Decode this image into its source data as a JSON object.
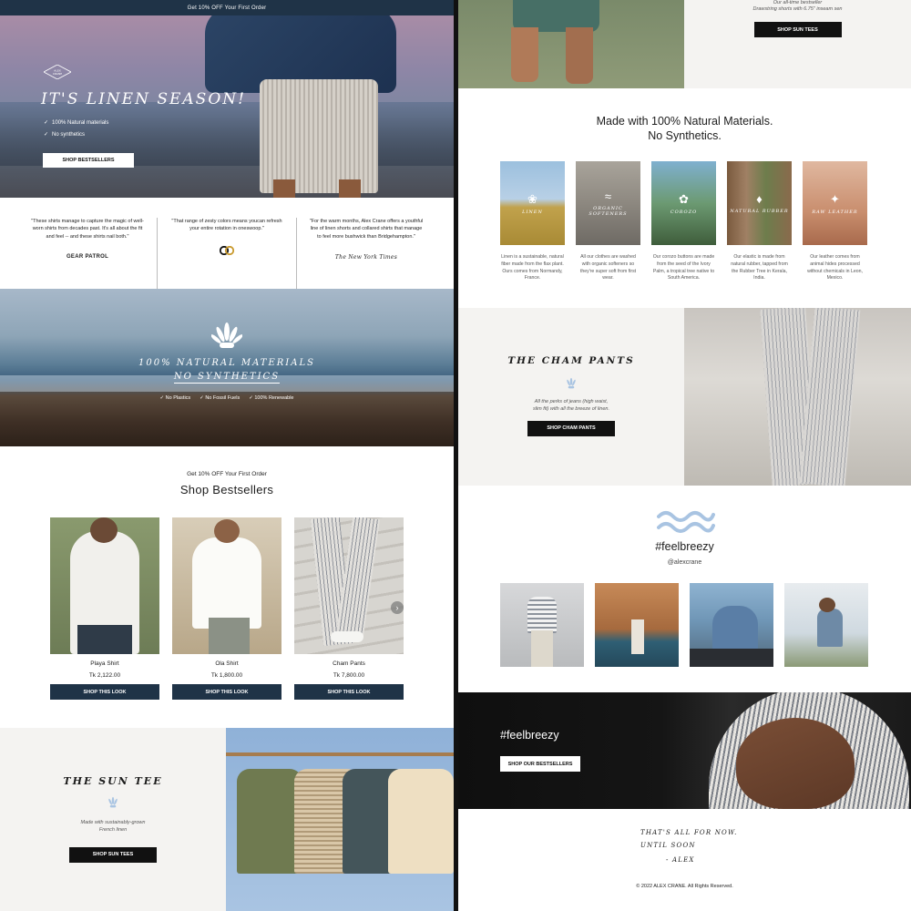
{
  "left": {
    "announcement": "Get 10% OFF Your First Order",
    "hero": {
      "logo_text": "ALEX CRANE",
      "tagline": "IT'S LINEN SEASON!",
      "bullets": [
        "100% Natural materials",
        "No synthetics"
      ],
      "button": "SHOP BESTSELLERS"
    },
    "press": [
      {
        "quote": "\"These shirts manage to capture the magic of well-worn shirts from decades past. It's all about the fit and feel -- and these shirts nail both.\"",
        "source": "GEAR PATROL"
      },
      {
        "quote": "\"That range of zesty colors means youcan refresh your entire rotation in oneswoop.\"",
        "source": "GQ"
      },
      {
        "quote": "\"For the warm months, Alex Crane offers a youthful line of linen shorts and collared shirts that manage to feel more bushwick than Bridgehampton.\"",
        "source": "The New York Times"
      }
    ],
    "natural_banner": {
      "line1": "100% NATURAL MATERIALS",
      "line2": "NO SYNTHETICS",
      "checks": [
        "No Plastics",
        "No Fossil Fuels",
        "100% Renewable"
      ]
    },
    "bestsellers": {
      "promo": "Get 10% OFF Your First Order",
      "title": "Shop Bestsellers",
      "products": [
        {
          "name": "Playa Shirt",
          "price": "Tk 2,122.00",
          "button": "SHOP THIS LOOK"
        },
        {
          "name": "Ola Shirt",
          "price": "Tk 1,800.00",
          "button": "SHOP THIS LOOK"
        },
        {
          "name": "Cham Pants",
          "price": "Tk 7,800.00",
          "button": "SHOP THIS LOOK"
        }
      ],
      "next_arrow": "›"
    },
    "suntee": {
      "title": "THE SUN TEE",
      "desc_line1": "Made with sustainably-grown",
      "desc_line2": "French linen",
      "button": "SHOP SUN TEES"
    }
  },
  "right": {
    "top": {
      "line1": "Our all-time bestseller",
      "line2": "Drawstring shorts with 6.75\" inseam sen",
      "button": "SHOP SUN TEES"
    },
    "materials": {
      "heading1": "Made with 100% Natural Materials.",
      "heading2": "No Synthetics.",
      "items": [
        {
          "label": "LINEN",
          "text": "Linen is a sustainable, natural fiber made from the flax plant. Ours comes from Normandy, France."
        },
        {
          "label": "ORGANIC SOFTENERS",
          "text": "All our clothes are washed with organic softeners so they're super soft from first wear."
        },
        {
          "label": "COROZO",
          "text": "Our corozo buttons are made from the seed of the Ivory Palm, a tropical tree native to South America."
        },
        {
          "label": "NATURAL RUBBER",
          "text": "Our elastic is made from natural rubber, tapped from the Rubber Tree in Kerala, India."
        },
        {
          "label": "RAW LEATHER",
          "text": "Our leather comes from animal hides processed without chemicals in Leon, Mexico."
        }
      ]
    },
    "cham": {
      "title": "THE CHAM PANTS",
      "desc_line1": "All the perks of jeans (high waist,",
      "desc_line2": "slim fit) with all the breeze of linen.",
      "button": "SHOP CHAM PANTS"
    },
    "breezy": {
      "hashtag": "#feelbreezy",
      "handle": "@alexcrane"
    },
    "dark_banner": {
      "hashtag": "#feelbreezy",
      "button": "SHOP OUR BESTSELLERS"
    },
    "footer": {
      "line1": "THAT'S ALL FOR NOW.",
      "line2": "UNTIL SOON",
      "line3": "- ALEX",
      "copyright": "© 2022 ALEX CRANE. All Rights Reserved."
    }
  }
}
